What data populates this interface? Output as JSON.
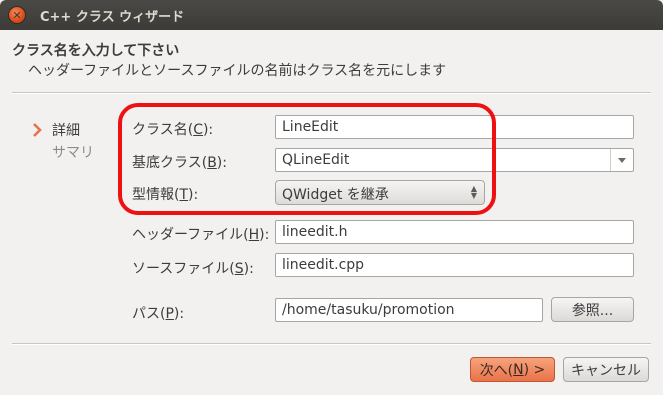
{
  "window": {
    "title": "C++ クラス ウィザード",
    "close_icon_glyph": "✕"
  },
  "header": {
    "title": "クラス名を入力して下さい",
    "subtitle": "ヘッダーファイルとソースファイルの名前はクラス名を元にします"
  },
  "steps": [
    {
      "label": "詳細",
      "active": true
    },
    {
      "label": "サマリ",
      "active": false
    }
  ],
  "form": {
    "class_name": {
      "label": "クラス名(",
      "mnemonic": "C",
      "label_end": "):",
      "value": "LineEdit"
    },
    "base_class": {
      "label": "基底クラス(",
      "mnemonic": "B",
      "label_end": "):",
      "value": "QLineEdit"
    },
    "type_info": {
      "label": "型情報(",
      "mnemonic": "T",
      "label_end": "):",
      "value": "QWidget を継承"
    },
    "header_file": {
      "label": "ヘッダーファイル(",
      "mnemonic": "H",
      "label_end": "):",
      "value": "lineedit.h"
    },
    "source_file": {
      "label": "ソースファイル(",
      "mnemonic": "S",
      "label_end": "):",
      "value": "lineedit.cpp"
    },
    "path": {
      "label": "パス(",
      "mnemonic": "P",
      "label_end": "):",
      "value": "/home/tasuku/promotion",
      "browse_label": "参照..."
    }
  },
  "footer": {
    "next": {
      "label": "次へ(",
      "mnemonic": "N",
      "label_end": ") >"
    },
    "cancel_label": "キャンセル"
  },
  "colors": {
    "accent": "#e9734a",
    "highlight": "#ee1111",
    "titlebar": "#3c3b37"
  }
}
